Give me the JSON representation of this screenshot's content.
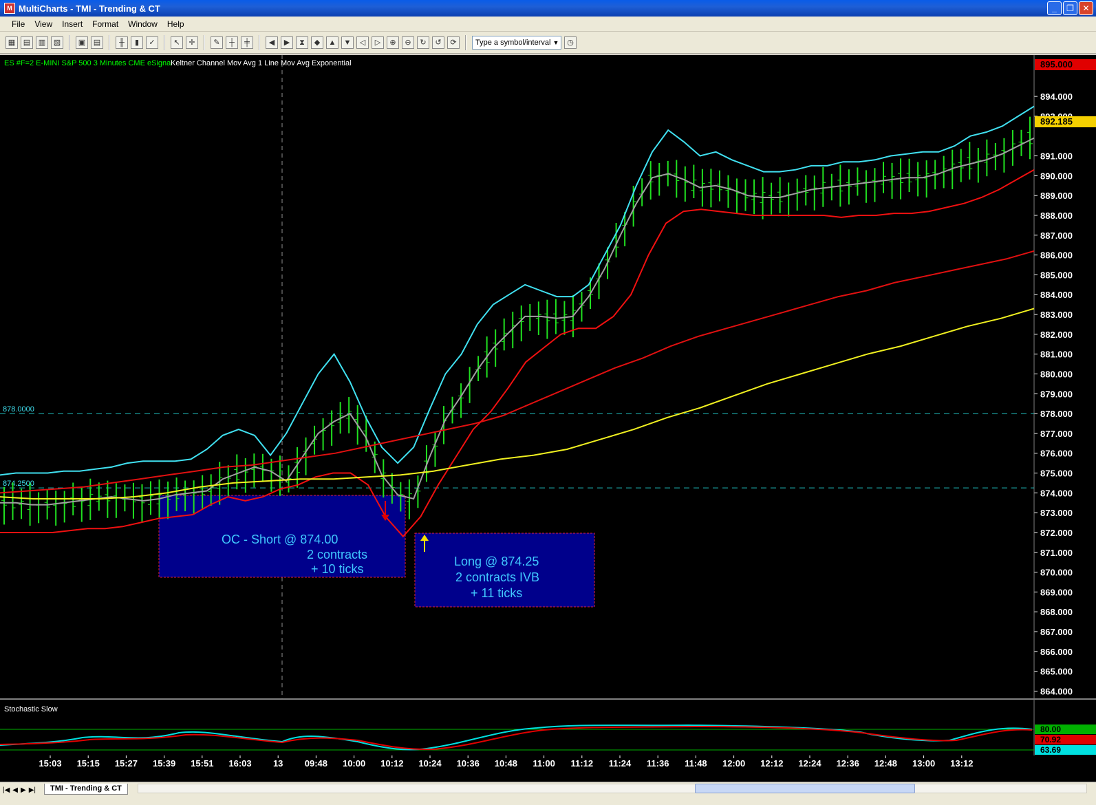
{
  "window": {
    "title": "MultiCharts - TMI - Trending & CT",
    "controls": [
      "_",
      "❐",
      "✕"
    ]
  },
  "menu": [
    "File",
    "View",
    "Insert",
    "Format",
    "Window",
    "Help"
  ],
  "toolbar": {
    "symbol_placeholder": "Type a symbol/interval"
  },
  "chart_header": {
    "symbol_info": "ES #F=2  E-MINI S&P 500  3 Minutes  CME  eSignal",
    "studies": "Keltner Channel  Mov Avg 1 Line  Mov Avg Exponential"
  },
  "price_axis": {
    "labels": [
      "894.000",
      "893.000",
      "891.000",
      "890.000",
      "889.000",
      "888.000",
      "887.000",
      "886.000",
      "885.000",
      "884.000",
      "883.000",
      "882.000",
      "881.000",
      "880.000",
      "879.000",
      "878.000",
      "877.000",
      "876.000",
      "875.000",
      "874.000",
      "873.000",
      "872.000",
      "871.000",
      "870.000",
      "869.000",
      "868.000",
      "867.000",
      "866.000",
      "865.000",
      "864.000"
    ],
    "top_price_tag": "895.000",
    "current_price_tag": "892.185",
    "colors": {
      "top_tag": "#e00000",
      "current_tag": "#f5d000"
    }
  },
  "hlines": [
    {
      "label": "878.0000",
      "price": 878.0
    },
    {
      "label": "874.2500",
      "price": 874.25
    }
  ],
  "annotations": {
    "short": {
      "line1": "OC - Short @ 874.00",
      "line2": "2 contracts",
      "line3": "+ 10 ticks"
    },
    "long": {
      "line1": "Long @ 874.25",
      "line2": "2 contracts IVB",
      "line3": "+ 11  ticks"
    }
  },
  "stochastic": {
    "title": "Stochastic Slow",
    "tags": [
      {
        "text": "80.00",
        "color": "#00b000"
      },
      {
        "text": "70.92",
        "color": "#e00000"
      },
      {
        "text": "63.69",
        "color": "#00e0e0"
      }
    ]
  },
  "time_axis": [
    "15:03",
    "15:15",
    "15:27",
    "15:39",
    "15:51",
    "16:03",
    "13",
    "09:48",
    "10:00",
    "10:12",
    "10:24",
    "10:36",
    "10:48",
    "11:00",
    "11:12",
    "11:24",
    "11:36",
    "11:48",
    "12:00",
    "12:12",
    "12:24",
    "12:36",
    "12:48",
    "13:00",
    "13:12"
  ],
  "tabs": {
    "active": "TMI - Trending & CT"
  },
  "chart_data": {
    "type": "line",
    "title": "",
    "ylim": [
      863.6,
      895.6
    ],
    "series": [
      {
        "name": "Keltner upper",
        "color": "#40e0f0",
        "values": [
          874.9,
          875.0,
          875.0,
          875.0,
          875.1,
          875.1,
          875.2,
          875.3,
          875.5,
          875.6,
          875.6,
          875.6,
          875.7,
          876.2,
          876.9,
          877.2,
          876.9,
          875.9,
          877.0,
          878.5,
          880.0,
          881.0,
          879.6,
          877.8,
          876.3,
          875.5,
          876.3,
          878.2,
          880.0,
          881.0,
          882.5,
          883.5,
          884.0,
          884.5,
          884.2,
          883.9,
          883.9,
          884.5,
          886.0,
          887.5,
          889.5,
          891.2,
          892.3,
          891.7,
          891.0,
          891.2,
          890.8,
          890.5,
          890.2,
          890.2,
          890.3,
          890.5,
          890.5,
          890.7,
          890.7,
          890.8,
          891.0,
          891.1,
          891.2,
          891.2,
          891.5,
          892.0,
          892.2,
          892.5,
          893.0,
          893.5
        ]
      },
      {
        "name": "Keltner middle",
        "color": "#a0a0a0",
        "values": [
          873.5,
          873.5,
          873.4,
          873.4,
          873.5,
          873.6,
          873.7,
          873.8,
          873.7,
          873.6,
          873.7,
          873.9,
          874.0,
          874.1,
          874.7,
          875.0,
          875.3,
          875.1,
          874.6,
          875.8,
          877.0,
          877.6,
          878.0,
          876.8,
          874.9,
          873.9,
          873.7,
          875.8,
          877.7,
          878.9,
          880.2,
          881.3,
          882.1,
          882.9,
          882.9,
          882.8,
          882.9,
          883.9,
          885.3,
          887.0,
          888.6,
          889.9,
          890.1,
          889.8,
          889.4,
          889.5,
          889.3,
          889.0,
          888.9,
          888.9,
          889.1,
          889.3,
          889.4,
          889.5,
          889.6,
          889.7,
          889.8,
          889.9,
          889.9,
          890.1,
          890.4,
          890.6,
          890.8,
          891.1,
          891.5,
          891.9
        ]
      },
      {
        "name": "Keltner lower",
        "color": "#f01010",
        "values": [
          872.0,
          872.0,
          872.0,
          872.0,
          872.1,
          872.2,
          872.2,
          872.3,
          872.5,
          872.7,
          872.8,
          872.9,
          873.4,
          873.8,
          873.6,
          873.8,
          874.2,
          874.4,
          874.8,
          875.0,
          875.0,
          874.4,
          872.8,
          871.8,
          872.8,
          874.4,
          875.8,
          877.2,
          878.1,
          879.3,
          880.6,
          881.3,
          882.0,
          882.3,
          882.3,
          882.9,
          884.0,
          886.0,
          887.6,
          888.2,
          888.3,
          888.2,
          888.1,
          888.0,
          888.0,
          888.0,
          888.0,
          888.0,
          887.9,
          888.0,
          888.0,
          888.1,
          888.1,
          888.2,
          888.4,
          888.6,
          888.9,
          889.3,
          889.8,
          890.3
        ]
      },
      {
        "name": "Mov Avg 1 Line",
        "color": "#e01010",
        "values": [
          874.0,
          874.1,
          874.2,
          874.3,
          874.5,
          874.7,
          874.9,
          875.1,
          875.3,
          875.4,
          875.6,
          875.8,
          876.0,
          876.3,
          876.6,
          876.9,
          877.2,
          877.5,
          877.9,
          878.5,
          879.1,
          879.7,
          880.3,
          880.8,
          881.4,
          881.9,
          882.3,
          882.7,
          883.1,
          883.5,
          883.9,
          884.2,
          884.6,
          884.9,
          885.2,
          885.5,
          885.8,
          886.2
        ]
      },
      {
        "name": "Mov Avg Exponential",
        "color": "#f0f020",
        "values": [
          873.8,
          873.7,
          873.7,
          873.7,
          873.8,
          874.0,
          874.3,
          874.5,
          874.6,
          874.7,
          874.7,
          874.8,
          874.9,
          875.1,
          875.4,
          875.7,
          875.9,
          876.2,
          876.7,
          877.2,
          877.8,
          878.3,
          878.9,
          879.5,
          880.0,
          880.5,
          881.0,
          881.4,
          881.9,
          882.4,
          882.8,
          883.3
        ]
      }
    ]
  }
}
